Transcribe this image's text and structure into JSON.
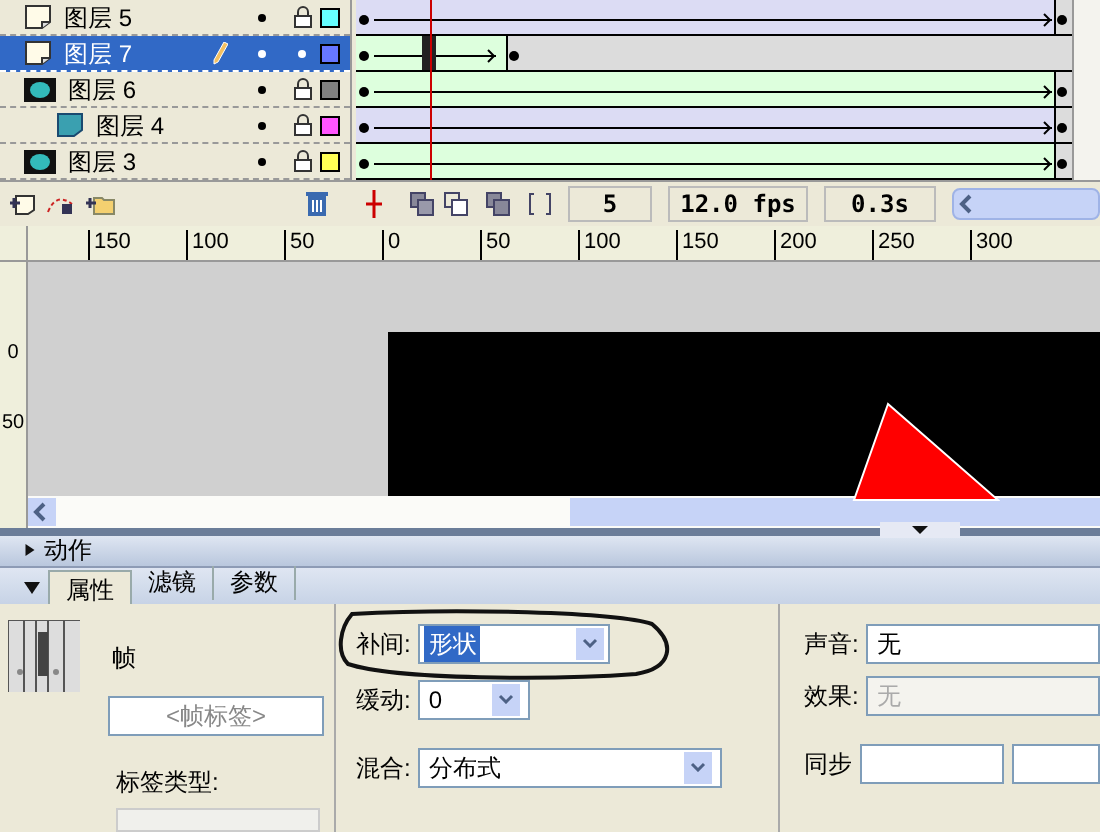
{
  "timeline": {
    "layers": [
      {
        "name": "图层 5",
        "kind": "normal",
        "selected": false,
        "editing": false,
        "locked": true,
        "color": "#66ffff",
        "shape_tween": false,
        "to_end": true
      },
      {
        "name": "图层 7",
        "kind": "normal",
        "selected": true,
        "editing": true,
        "locked": false,
        "color": "#6677ff",
        "shape_tween": true,
        "to_end": false
      },
      {
        "name": "图层 6",
        "kind": "mask",
        "selected": false,
        "editing": false,
        "locked": true,
        "color": "#808080",
        "shape_tween": true,
        "to_end": true,
        "children": [
          {
            "name": "图层 4",
            "kind": "masked",
            "selected": false,
            "editing": false,
            "locked": true,
            "color": "#ff55ff",
            "shape_tween": false,
            "to_end": true
          }
        ]
      },
      {
        "name": "图层 3",
        "kind": "mask",
        "selected": false,
        "editing": false,
        "locked": true,
        "color": "#ffff55",
        "shape_tween": true,
        "to_end": true
      }
    ],
    "current_frame": "5",
    "frame_rate": "12.0 fps",
    "elapsed_time": "0.3s"
  },
  "rulers": {
    "horizontal": [
      "150",
      "100",
      "50",
      "0",
      "50",
      "100",
      "150",
      "200",
      "250",
      "300"
    ],
    "vertical": [
      "0",
      "50"
    ]
  },
  "panels": [
    {
      "title": "动作",
      "expanded": false
    }
  ],
  "properties": {
    "tabs": [
      {
        "label": "属性",
        "selected": true
      },
      {
        "label": "滤镜",
        "selected": false
      },
      {
        "label": "参数",
        "selected": false
      }
    ],
    "frame_heading": "帧",
    "frame_label": {
      "placeholder": "<帧标签>"
    },
    "label_type": "标签类型:",
    "tween": {
      "label": "补间:",
      "value": "形状"
    },
    "ease": {
      "label": "缓动:",
      "value": "0"
    },
    "blend": {
      "label": "混合:",
      "value": "分布式"
    },
    "sound": {
      "label": "声音:",
      "value": "无"
    },
    "effect": {
      "label": "效果:",
      "value": "无",
      "disabled": true
    },
    "sync": {
      "label": "同步"
    }
  }
}
